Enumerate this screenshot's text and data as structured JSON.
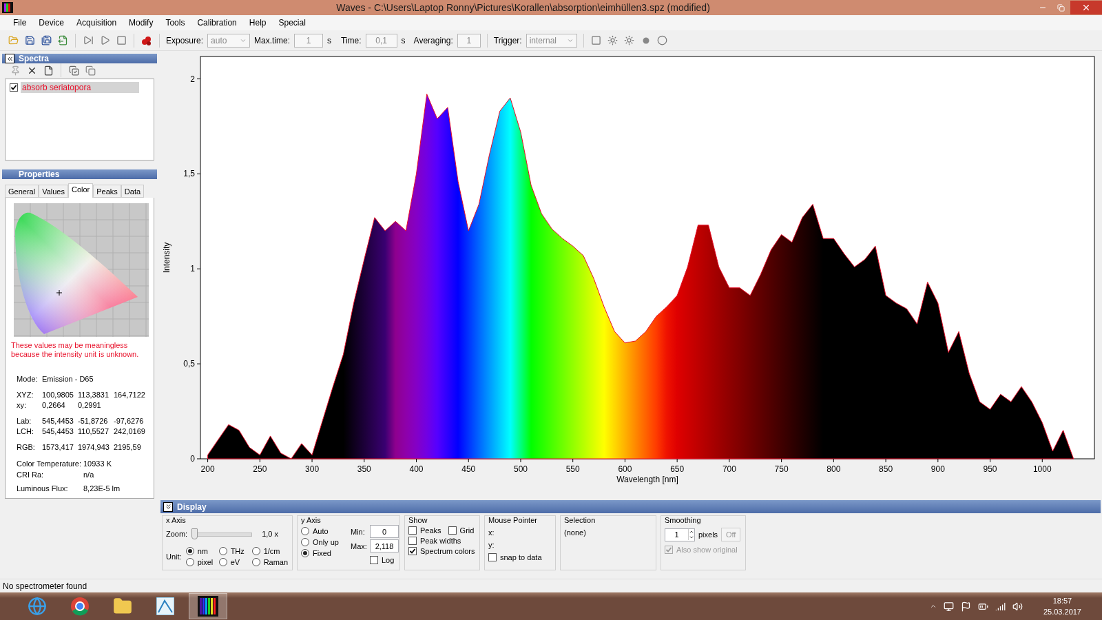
{
  "window": {
    "title": "Waves  -  C:\\Users\\Laptop Ronny\\Pictures\\Korallen\\absorption\\eimhüllen3.spz  (modified)"
  },
  "menu": [
    "File",
    "Device",
    "Acquisition",
    "Modify",
    "Tools",
    "Calibration",
    "Help",
    "Special"
  ],
  "toolbar": {
    "exposure": {
      "label": "Exposure:",
      "value": "auto",
      "disabled": true
    },
    "max_time": {
      "label": "Max.time:",
      "value": "1",
      "unit": "s",
      "disabled": true
    },
    "time": {
      "label": "Time:",
      "value": "0,1",
      "unit": "s",
      "disabled": true
    },
    "averaging": {
      "label": "Averaging:",
      "value": "1",
      "disabled": true
    },
    "trigger": {
      "label": "Trigger:",
      "value": "internal",
      "disabled": true
    }
  },
  "spectra_panel": {
    "title": "Spectra",
    "items": [
      {
        "name": "absorb seriatopora",
        "checked": true,
        "selected": true,
        "color": "#e8102a"
      }
    ]
  },
  "properties_panel": {
    "title": "Properties",
    "tabs": [
      {
        "label": "General",
        "selected": false
      },
      {
        "label": "Values",
        "selected": false
      },
      {
        "label": "Color",
        "selected": true
      },
      {
        "label": "Peaks",
        "selected": false
      },
      {
        "label": "Data",
        "selected": false
      }
    ],
    "warning": "These values may be meaningless because the intensity unit is unknown.",
    "groups": [
      [
        {
          "label": "Mode:",
          "values": [
            "Emission - D65"
          ]
        }
      ],
      [
        {
          "label": "XYZ:",
          "values": [
            "100,9805",
            "113,3831",
            "164,7122"
          ]
        },
        {
          "label": "xy:",
          "values": [
            "0,2664",
            "0,2991"
          ]
        }
      ],
      [
        {
          "label": "Lab:",
          "values": [
            "545,4453",
            "-51,8726",
            "-97,6276"
          ]
        },
        {
          "label": "LCH:",
          "values": [
            "545,4453",
            "110,5527",
            "242,0169"
          ]
        }
      ],
      [
        {
          "label": "RGB:",
          "values": [
            "1573,417",
            "1974,943",
            "2195,59"
          ]
        }
      ]
    ],
    "metrics": [
      {
        "label": "Color Temperature:",
        "value": "10933 K"
      },
      {
        "label": "CRI Ra:",
        "value": "n/a"
      },
      {
        "label": "Luminous Flux:",
        "value": "8,23E-5 lm"
      }
    ]
  },
  "chart": {
    "chart_data": {
      "type": "area",
      "xlabel": "Wavelength [nm]",
      "ylabel": "Intensity",
      "xlim": [
        193,
        1050
      ],
      "ylim": [
        0,
        2.118
      ],
      "xticks": [
        200,
        250,
        300,
        350,
        400,
        450,
        500,
        550,
        600,
        650,
        700,
        750,
        800,
        850,
        900,
        950,
        1000
      ],
      "yticks": [
        0,
        {
          "value": 0.5,
          "label": "0,5"
        },
        1,
        {
          "value": 1.5,
          "label": "1,5"
        },
        2
      ],
      "x": [
        200,
        210,
        220,
        230,
        240,
        250,
        260,
        270,
        280,
        290,
        300,
        310,
        320,
        330,
        340,
        350,
        360,
        370,
        380,
        390,
        400,
        410,
        420,
        430,
        440,
        450,
        460,
        470,
        480,
        490,
        500,
        510,
        520,
        530,
        540,
        550,
        560,
        570,
        580,
        590,
        600,
        610,
        620,
        630,
        640,
        650,
        660,
        670,
        680,
        690,
        700,
        710,
        720,
        730,
        740,
        750,
        760,
        770,
        780,
        790,
        800,
        810,
        820,
        830,
        840,
        850,
        860,
        870,
        880,
        890,
        900,
        910,
        920,
        930,
        940,
        950,
        960,
        970,
        980,
        990,
        1000,
        1010,
        1020,
        1030
      ],
      "series": [
        {
          "color": "#e8102a",
          "values": [
            0.02,
            0.1,
            0.18,
            0.15,
            0.06,
            0.02,
            0.12,
            0.03,
            0.0,
            0.08,
            0.02,
            0.2,
            0.38,
            0.55,
            0.82,
            1.05,
            1.27,
            1.2,
            1.25,
            1.2,
            1.5,
            1.92,
            1.79,
            1.85,
            1.46,
            1.2,
            1.34,
            1.6,
            1.83,
            1.9,
            1.72,
            1.44,
            1.29,
            1.21,
            1.16,
            1.12,
            1.07,
            0.95,
            0.8,
            0.67,
            0.61,
            0.62,
            0.67,
            0.75,
            0.8,
            0.86,
            1.01,
            1.23,
            1.23,
            1.01,
            0.9,
            0.9,
            0.86,
            0.97,
            1.1,
            1.18,
            1.14,
            1.27,
            1.34,
            1.16,
            1.16,
            1.08,
            1.01,
            1.05,
            1.12,
            0.86,
            0.82,
            0.79,
            0.71,
            0.93,
            0.82,
            0.56,
            0.67,
            0.45,
            0.3,
            0.26,
            0.34,
            0.3,
            0.38,
            0.3,
            0.19,
            0.04,
            0.15,
            0.0
          ]
        }
      ]
    }
  },
  "display_panel": {
    "title": "Display",
    "x_axis": {
      "title": "x Axis",
      "zoom_label": "Zoom:",
      "zoom": {
        "level": 0
      },
      "zoom_value": "1,0 x",
      "unit_label": "Unit:",
      "units": [
        {
          "label": "nm",
          "selected": true
        },
        {
          "label": "THz",
          "selected": false
        },
        {
          "label": "1/cm",
          "selected": false
        },
        {
          "label": "pixel",
          "selected": false
        },
        {
          "label": "eV",
          "selected": false
        },
        {
          "label": "Raman",
          "selected": false
        }
      ]
    },
    "y_axis": {
      "title": "y Axis",
      "modes": [
        {
          "label": "Auto",
          "selected": false
        },
        {
          "label": "Only up",
          "selected": false
        },
        {
          "label": "Fixed",
          "selected": true
        }
      ],
      "min_label": "Min:",
      "min": "0",
      "max_label": "Max:",
      "max": "2,118",
      "log": {
        "label": "Log",
        "checked": false
      }
    },
    "show": {
      "title": "Show",
      "options": [
        {
          "label": "Peaks",
          "checked": false
        },
        {
          "label": "Grid",
          "checked": false
        },
        {
          "label": "Peak widths",
          "checked": false
        },
        {
          "label": "Spectrum colors",
          "checked": true
        }
      ]
    },
    "mouse_pointer": {
      "title": "Mouse Pointer",
      "x_label": "x:",
      "y_label": "y:",
      "snap": {
        "label": "snap to data",
        "checked": false
      }
    },
    "selection": {
      "title": "Selection",
      "value": "(none)"
    },
    "smoothing": {
      "title": "Smoothing",
      "value": "1",
      "unit": "pixels",
      "button": "Off",
      "also_show": {
        "label": "Also show original",
        "checked": true,
        "disabled": true
      }
    }
  },
  "status_bar": "No spectrometer found",
  "taskbar": {
    "time": "18:57",
    "date": "25.03.2017"
  }
}
